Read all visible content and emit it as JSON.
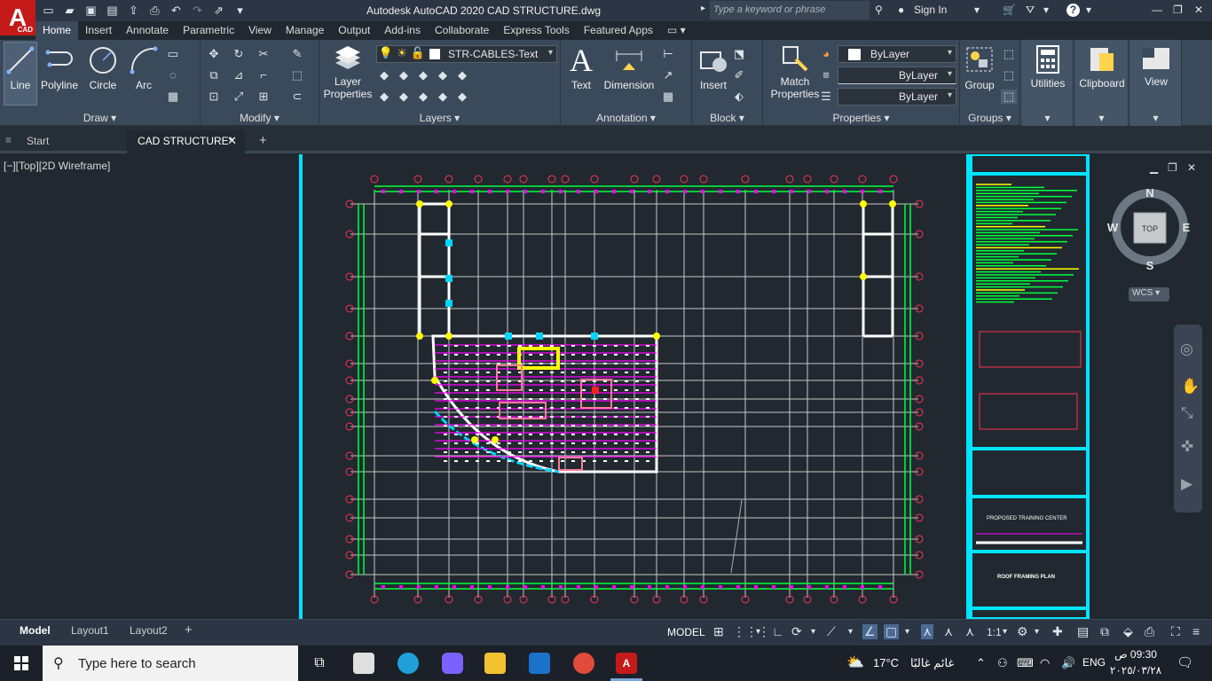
{
  "titlebar": {
    "app_logo_letter": "A",
    "app_logo_sub": "CAD",
    "title": "Autodesk AutoCAD 2020    CAD STRUCTURE.dwg",
    "search_placeholder": "Type a keyword or phrase",
    "sign_in": "Sign In",
    "help": "?"
  },
  "ribbon_tabs": [
    "Home",
    "Insert",
    "Annotate",
    "Parametric",
    "View",
    "Manage",
    "Output",
    "Add-ins",
    "Collaborate",
    "Express Tools",
    "Featured Apps"
  ],
  "ribbon": {
    "draw": {
      "title": "Draw",
      "line": "Line",
      "polyline": "Polyline",
      "circle": "Circle",
      "arc": "Arc"
    },
    "modify": {
      "title": "Modify"
    },
    "layers": {
      "title": "Layers",
      "layer_properties_1": "Layer",
      "layer_properties_2": "Properties",
      "current_layer": "STR-CABLES-Text"
    },
    "annotation": {
      "title": "Annotation",
      "text": "Text",
      "dimension": "Dimension"
    },
    "block": {
      "title": "Block",
      "insert": "Insert"
    },
    "properties": {
      "title": "Properties",
      "match_1": "Match",
      "match_2": "Properties",
      "color": "ByLayer",
      "linetype": "ByLayer",
      "lineweight": "ByLayer"
    },
    "groups": {
      "title": "Groups",
      "group": "Group"
    },
    "utilities": "Utilities",
    "clipboard": "Clipboard",
    "view": "View"
  },
  "doc_tabs": {
    "start": "Start",
    "active": "CAD STRUCTURE*",
    "new": "+"
  },
  "viewport": {
    "label": "[−][Top][2D Wireframe]",
    "compass": {
      "n": "N",
      "s": "S",
      "e": "E",
      "w": "W",
      "top": "TOP"
    },
    "wcs": "WCS"
  },
  "title_block": {
    "project": "PROPOSED TRAINING CENTER",
    "sheet": "ROOF FRAMING PLAN"
  },
  "layout_tabs": [
    "Model",
    "Layout1",
    "Layout2"
  ],
  "status": {
    "model": "MODEL",
    "scale": "1:1"
  },
  "taskbar": {
    "search": "Type here to search",
    "weather_temp": "17°C",
    "weather_desc": "غائم غالبًا",
    "lang": "ENG",
    "time": "09:30 ص",
    "date": "٢٠٢٥/٠٣/٢٨"
  },
  "colors": {
    "accent_cyan": "#00e5ff",
    "grid_green": "#00ff3c",
    "magenta": "#ff00ff",
    "logo_red": "#c51a1a"
  }
}
